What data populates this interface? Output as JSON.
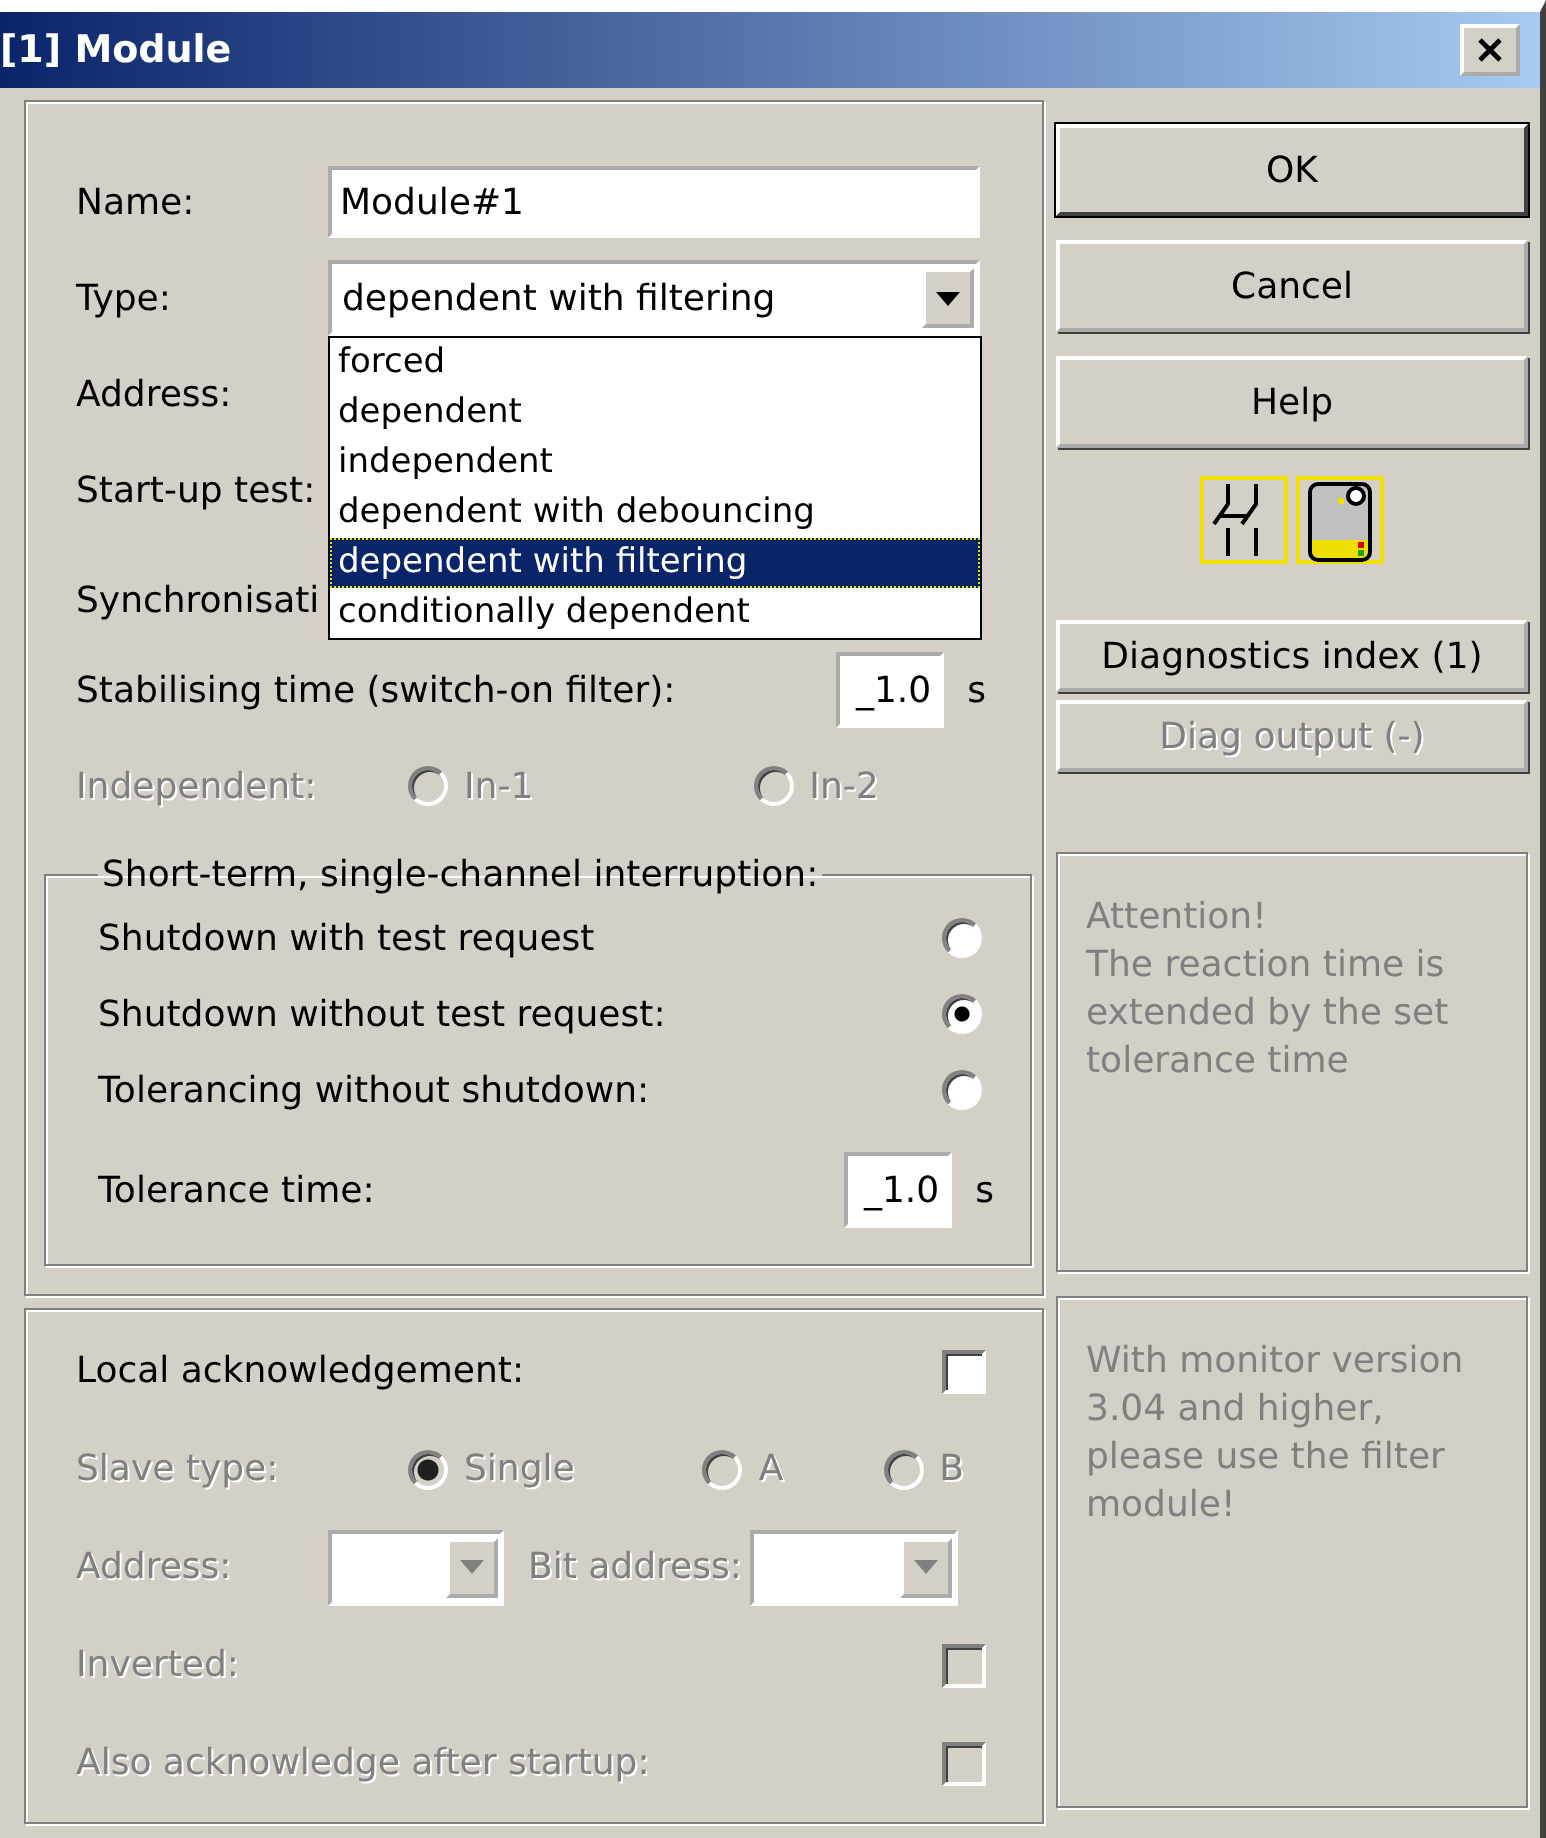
{
  "window": {
    "title": "[1] Module"
  },
  "general": {
    "name": {
      "label": "Name:",
      "value": "Module#1"
    },
    "type": {
      "label": "Type:",
      "value": "dependent with filtering",
      "expanded": true,
      "options": [
        {
          "label": "forced",
          "selected": false
        },
        {
          "label": "dependent",
          "selected": false
        },
        {
          "label": "independent",
          "selected": false
        },
        {
          "label": "dependent with debouncing",
          "selected": false
        },
        {
          "label": "dependent with filtering",
          "selected": true
        },
        {
          "label": "conditionally dependent",
          "selected": false
        }
      ]
    },
    "covered_labels": [
      "Address:",
      "Start-up test:",
      "Synchronisati"
    ],
    "stabilising": {
      "label": "Stabilising time (switch-on filter):",
      "value": "_1.0",
      "unit": "s"
    },
    "independent": {
      "label": "Independent:",
      "disabled": true,
      "options": [
        {
          "label": "In-1",
          "selected": false
        },
        {
          "label": "In-2",
          "selected": false
        }
      ]
    }
  },
  "interruption": {
    "title": "Short-term, single-channel interruption:",
    "options": [
      {
        "label": "Shutdown with test request",
        "selected": false
      },
      {
        "label": "Shutdown without test request:",
        "selected": true
      },
      {
        "label": "Tolerancing without shutdown:",
        "selected": false
      }
    ],
    "tolerance": {
      "label": "Tolerance time:",
      "value": "_1.0",
      "unit": "s"
    }
  },
  "acknowledgement": {
    "local": {
      "label": "Local acknowledgement:",
      "checked": false,
      "disabled": false
    },
    "slave_type": {
      "label": "Slave type:",
      "disabled": true,
      "options": [
        {
          "label": "Single",
          "selected": true
        },
        {
          "label": "A",
          "selected": false
        },
        {
          "label": "B",
          "selected": false
        }
      ]
    },
    "address": {
      "label": "Address:",
      "disabled": true
    },
    "bit_address": {
      "label": "Bit address:",
      "disabled": true
    },
    "inverted": {
      "label": "Inverted:",
      "checked": false,
      "disabled": true
    },
    "after_startup": {
      "label": "Also acknowledge after startup:",
      "checked": false,
      "disabled": true
    }
  },
  "buttons": [
    {
      "label": "OK",
      "default": true,
      "disabled": false
    },
    {
      "label": "Cancel",
      "default": false,
      "disabled": false
    },
    {
      "label": "Help",
      "default": false,
      "disabled": false
    }
  ],
  "diag_buttons": [
    {
      "label": "Diagnostics index (1)",
      "disabled": false
    },
    {
      "label": "Diag output (-)",
      "disabled": true
    }
  ],
  "notes": [
    "Attention!\nThe reaction time is extended by the set tolerance time",
    "With monitor version 3.04 and higher, please use the filter module!"
  ]
}
